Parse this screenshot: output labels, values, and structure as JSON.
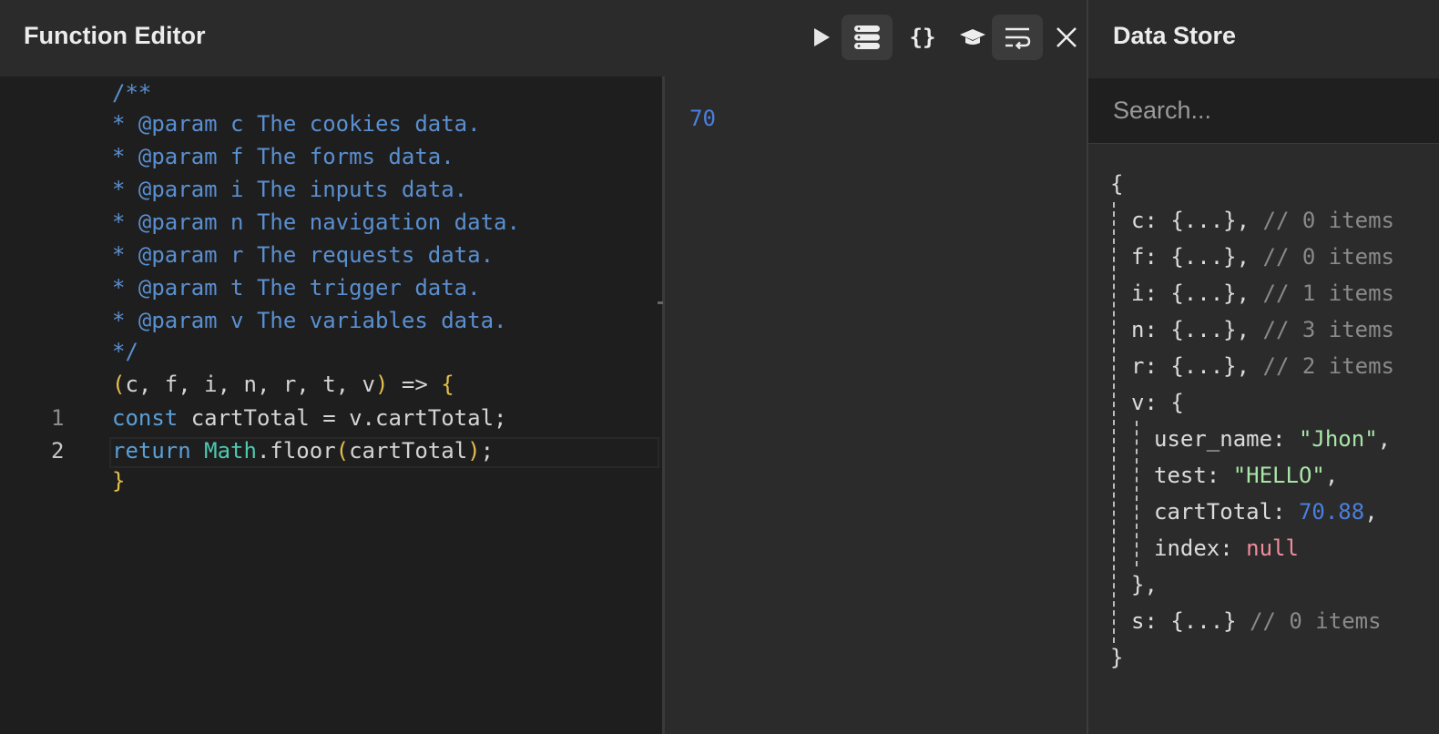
{
  "editor": {
    "title": "Function Editor",
    "toolbar": [
      {
        "icon": "play-icon"
      },
      {
        "icon": "database-icon"
      },
      {
        "icon": "braces-icon"
      },
      {
        "icon": "graduation-cap-icon"
      },
      {
        "icon": "word-wrap-icon"
      },
      {
        "icon": "close-icon"
      }
    ],
    "code": {
      "doc_comment": [
        "/**",
        "* @param c The cookies data.",
        "* @param f The forms data.",
        "* @param i The inputs data.",
        "* @param n The navigation data.",
        "* @param r The requests data.",
        "* @param t The trigger data.",
        "* @param v The variables data.",
        "*/"
      ],
      "signature": {
        "open_paren": "(",
        "params": "c, f, i, n, r, t, v",
        "close_paren": ")",
        "arrow": " => ",
        "open_brace": "{"
      },
      "body": {
        "line1_num": "1",
        "line1_kw": "const",
        "line1_rest": " cartTotal = v.cartTotal;",
        "line2_num": "2",
        "line2_kw": "return",
        "line2_obj": "Math",
        "line2_method": ".floor",
        "line2_open": "(",
        "line2_arg": "cartTotal",
        "line2_close": ")",
        "line2_end": ";"
      },
      "close_brace": "}"
    }
  },
  "output": {
    "value": "70"
  },
  "store": {
    "title": "Data Store",
    "search_placeholder": "Search...",
    "open_brace": "{",
    "close_brace": "}",
    "entries": [
      {
        "key": "c",
        "value": "{...},",
        "comment": "// 0 items"
      },
      {
        "key": "f",
        "value": "{...},",
        "comment": "// 0 items"
      },
      {
        "key": "i",
        "value": "{...},",
        "comment": "// 1 items"
      },
      {
        "key": "n",
        "value": "{...},",
        "comment": "// 3 items"
      },
      {
        "key": "r",
        "value": "{...},",
        "comment": "// 2 items"
      }
    ],
    "v": {
      "key": "v",
      "open": "{",
      "close": "},",
      "fields": {
        "user_name": {
          "key": "user_name",
          "value": "\"Jhon\""
        },
        "test": {
          "key": "test",
          "value": "\"HELLO\""
        },
        "cartTotal": {
          "key": "cartTotal",
          "value": "70.88"
        },
        "index": {
          "key": "index",
          "value": "null"
        }
      }
    },
    "s": {
      "key": "s",
      "value": "{...}",
      "comment": "// 0 items"
    }
  }
}
